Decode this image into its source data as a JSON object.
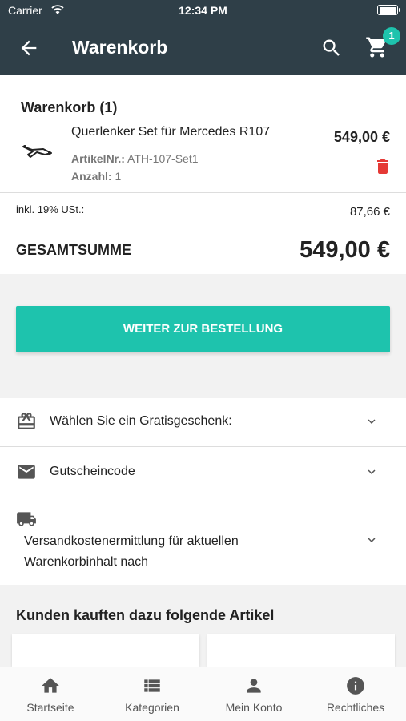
{
  "status_bar": {
    "carrier": "Carrier",
    "time": "12:34 PM"
  },
  "app_bar": {
    "title": "Warenkorb",
    "cart_count": "1"
  },
  "cart": {
    "heading": "Warenkorb (1)",
    "item": {
      "name": "Querlenker Set für Mercedes R107",
      "sku_label": "ArtikelNr.:",
      "sku": "ATH-107-Set1",
      "qty_label": "Anzahl:",
      "qty": "1",
      "price": "549,00 €"
    },
    "tax_label": "inkl. 19% USt.:",
    "tax_value": "87,66 €",
    "total_label": "GESAMTSUMME",
    "total_value": "549,00 €"
  },
  "checkout_button": "WEITER ZUR BESTELLUNG",
  "sections": {
    "gift": "Wählen Sie ein Gratisgeschenk:",
    "voucher": "Gutscheincode",
    "shipping_line1": "Versandkostenermittlung für aktuellen",
    "shipping_line2": "Warenkorbinhalt nach"
  },
  "recommendations_title": "Kunden kauften dazu folgende Artikel",
  "tabs": [
    {
      "label": "Startseite",
      "icon": "home-icon"
    },
    {
      "label": "Kategorien",
      "icon": "list-icon"
    },
    {
      "label": "Mein Konto",
      "icon": "person-icon"
    },
    {
      "label": "Rechtliches",
      "icon": "info-icon"
    }
  ],
  "colors": {
    "header": "#2f3f48",
    "accent": "#1ec3ad",
    "delete": "#e53935"
  }
}
